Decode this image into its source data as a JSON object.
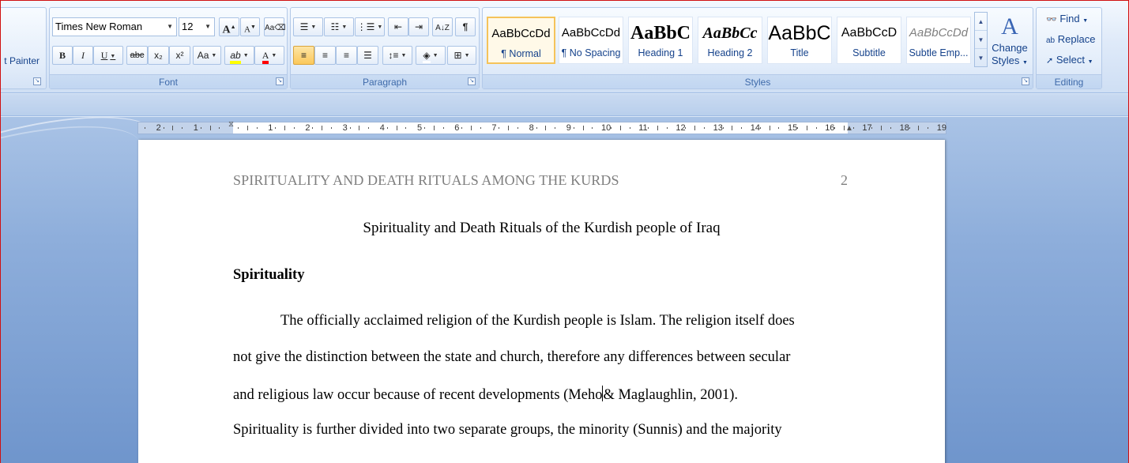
{
  "clipboard": {
    "format_painter_label": "t Painter"
  },
  "font_group": {
    "font_name": "Times New Roman",
    "font_size": "12",
    "grow_label": "A",
    "shrink_label": "A",
    "bold": "B",
    "italic": "I",
    "underline": "U",
    "strike": "abc",
    "subscript": "x₂",
    "superscript": "x²",
    "change_case": "Aa",
    "highlight": "ab",
    "font_color": "A",
    "label": "Font"
  },
  "paragraph_group": {
    "label": "Paragraph",
    "show_marks": "¶"
  },
  "styles_group": {
    "label": "Styles",
    "items": [
      {
        "sample": "AaBbCcDd",
        "name": "¶ Normal"
      },
      {
        "sample": "AaBbCcDd",
        "name": "¶ No Spacing"
      },
      {
        "sample": "AaBbC",
        "name": "Heading 1"
      },
      {
        "sample": "AaBbCc",
        "name": "Heading 2"
      },
      {
        "sample": "AaBbC",
        "name": "Title"
      },
      {
        "sample": "AaBbCcD",
        "name": "Subtitle"
      },
      {
        "sample": "AaBbCcDd",
        "name": "Subtle Emp..."
      }
    ],
    "change_styles_line1": "Change",
    "change_styles_line2": "Styles"
  },
  "editing_group": {
    "label": "Editing",
    "find": "Find",
    "replace": "Replace",
    "select": "Select"
  },
  "ruler": {
    "left_numbers": [
      "2",
      "1"
    ],
    "right_numbers": [
      "1",
      "2",
      "3",
      "4",
      "5",
      "6",
      "7",
      "8",
      "9",
      "10",
      "11",
      "12",
      "13",
      "14",
      "15",
      "16",
      "17",
      "18",
      "19"
    ]
  },
  "document": {
    "header_text": "SPIRITUALITY AND DEATH RITUALS AMONG THE KURDS",
    "page_number": "2",
    "title": "Spirituality and Death Rituals of the Kurdish people of Iraq",
    "heading": "Spirituality",
    "lines": [
      "The officially acclaimed religion of the Kurdish people is Islam. The religion itself does",
      "not give the distinction between the state and church, therefore any differences between secular",
      "and religious law occur because of recent developments (Meho",
      "& Maglaughlin, 2001).",
      "Spirituality is further divided into two separate groups, the minority (Sunnis) and the majority"
    ]
  }
}
